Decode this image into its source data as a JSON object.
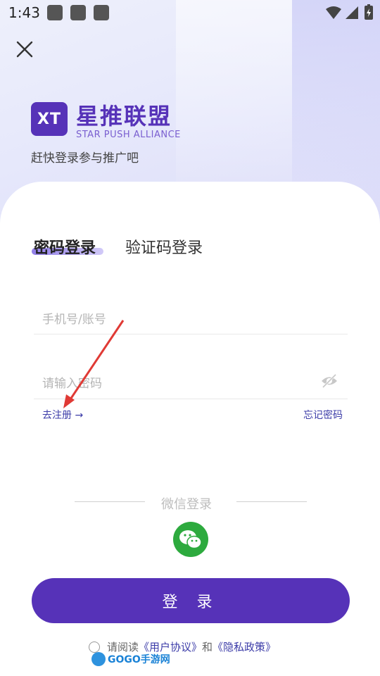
{
  "status_bar": {
    "time": "1:43"
  },
  "brand": {
    "logo_text": "XT",
    "name_cn": "星推联盟",
    "name_en": "STAR PUSH ALLIANCE",
    "tagline": "赶快登录参与推广吧"
  },
  "tabs": [
    {
      "label": "密码登录",
      "active": true
    },
    {
      "label": "验证码登录",
      "active": false
    }
  ],
  "form": {
    "account_placeholder": "手机号/账号",
    "password_placeholder": "请输入密码",
    "register_link": "去注册 →",
    "forgot_link": "忘记密码"
  },
  "wechat": {
    "label": "微信登录"
  },
  "login_button": "登 录",
  "agreement": {
    "prefix": "请阅读",
    "user_agreement": "《用户协议》",
    "and": "和",
    "privacy_policy": "《隐私政策》"
  },
  "watermark": {
    "text": "GOGO手游网"
  },
  "colors": {
    "primary": "#5632b8",
    "link": "#3c3ca8",
    "wechat": "#2daa3e",
    "annotation_arrow": "#e03a35"
  }
}
